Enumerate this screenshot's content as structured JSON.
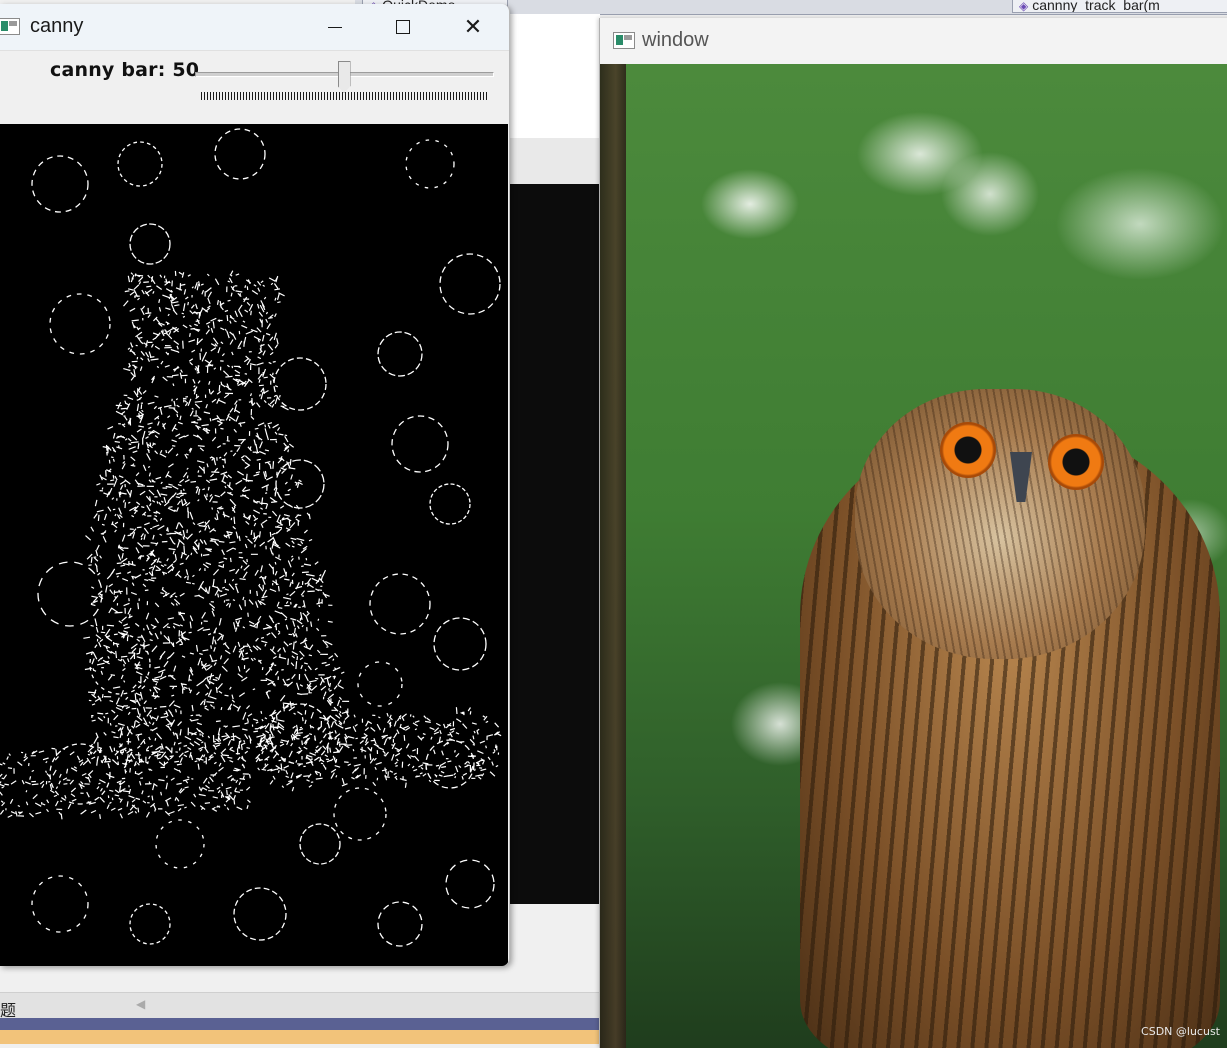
{
  "background_ide": {
    "tab_left_label": "QuickDemo",
    "tab_right_label": "cannny_track_bar(m",
    "bottom_bar_label": "题"
  },
  "canny_window": {
    "title": "canny",
    "controls": {
      "minimize": "minimize-icon",
      "maximize": "maximize-icon",
      "close": "close-icon"
    },
    "trackbar": {
      "label": "canny bar: 50",
      "value": 50
    },
    "image": "canny edge-detection output of the owl photo (white edges on black)"
  },
  "owl_window": {
    "title": "window",
    "image": "owl photo on green bokeh background",
    "watermark": "CSDN @lucust"
  },
  "colors": {
    "console_bg": "#0c0c0c",
    "status_bar": "#5a6193",
    "status_bar_yellow": "#f2c37a",
    "owl_eye": "#f07a12"
  }
}
